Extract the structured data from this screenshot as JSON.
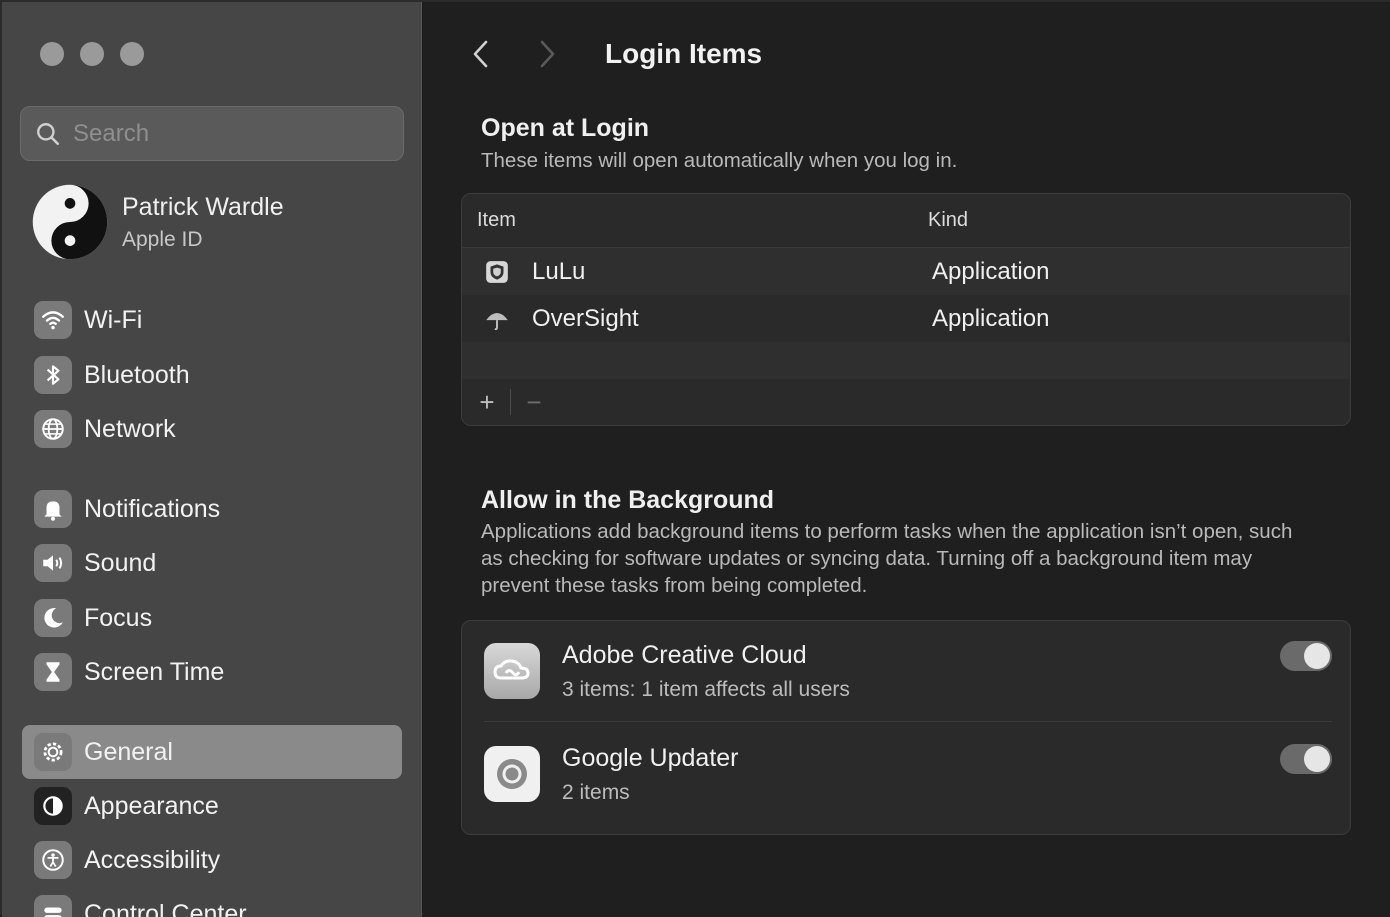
{
  "sidebar": {
    "search_placeholder": "Search",
    "account": {
      "name": "Patrick Wardle",
      "sub": "Apple ID"
    },
    "items": [
      {
        "label": "Wi-Fi",
        "icon": "wifi-icon"
      },
      {
        "label": "Bluetooth",
        "icon": "bluetooth-icon"
      },
      {
        "label": "Network",
        "icon": "globe-icon"
      },
      {
        "label": "Notifications",
        "icon": "bell-icon"
      },
      {
        "label": "Sound",
        "icon": "speaker-icon"
      },
      {
        "label": "Focus",
        "icon": "moon-icon"
      },
      {
        "label": "Screen Time",
        "icon": "hourglass-icon"
      },
      {
        "label": "General",
        "icon": "gear-icon",
        "selected": true
      },
      {
        "label": "Appearance",
        "icon": "appearance-icon"
      },
      {
        "label": "Accessibility",
        "icon": "accessibility-icon"
      },
      {
        "label": "Control Center",
        "icon": "control-center-icon"
      }
    ]
  },
  "main": {
    "title": "Login Items",
    "open_at_login": {
      "title": "Open at Login",
      "desc": "These items will open automatically when you log in.",
      "columns": [
        "Item",
        "Kind"
      ],
      "rows": [
        {
          "name": "LuLu",
          "kind": "Application",
          "icon": "shield-icon"
        },
        {
          "name": "OverSight",
          "kind": "Application",
          "icon": "umbrella-icon"
        }
      ],
      "add_label": "+",
      "remove_label": "−"
    },
    "background": {
      "title": "Allow in the Background",
      "desc": "Applications add background items to perform tasks when the application isn’t open, such as checking for software updates or syncing data. Turning off a background item may prevent these tasks from being completed.",
      "items": [
        {
          "name": "Adobe Creative Cloud",
          "detail": "3 items: 1 item affects all users",
          "enabled": true,
          "icon": "creative-cloud-icon"
        },
        {
          "name": "Google Updater",
          "detail": "2 items",
          "enabled": true,
          "icon": "google-updater-icon"
        }
      ]
    }
  }
}
